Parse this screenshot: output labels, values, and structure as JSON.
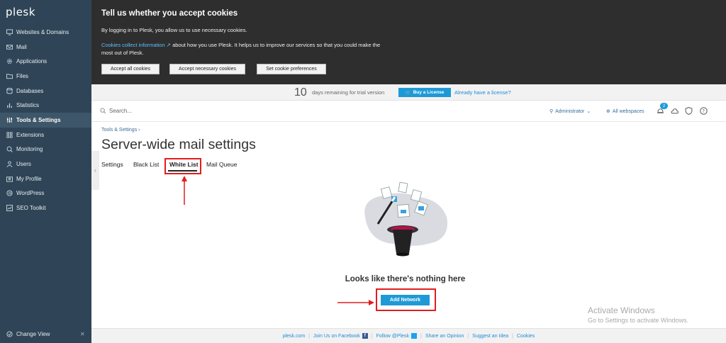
{
  "app": {
    "logo": "plesk"
  },
  "sidebar": {
    "items": [
      {
        "label": "Websites & Domains",
        "icon": "monitor-icon"
      },
      {
        "label": "Mail",
        "icon": "mail-icon"
      },
      {
        "label": "Applications",
        "icon": "gear-icon"
      },
      {
        "label": "Files",
        "icon": "folder-icon"
      },
      {
        "label": "Databases",
        "icon": "database-icon"
      },
      {
        "label": "Statistics",
        "icon": "bar-chart-icon"
      },
      {
        "label": "Tools & Settings",
        "icon": "sliders-icon",
        "active": true
      },
      {
        "label": "Extensions",
        "icon": "grid-icon"
      },
      {
        "label": "Monitoring",
        "icon": "monitoring-icon"
      },
      {
        "label": "Users",
        "icon": "user-icon"
      },
      {
        "label": "My Profile",
        "icon": "profile-icon"
      },
      {
        "label": "WordPress",
        "icon": "wordpress-icon"
      },
      {
        "label": "SEO Toolkit",
        "icon": "seo-icon"
      }
    ],
    "change_view": "Change View"
  },
  "cookie": {
    "title": "Tell us whether you accept cookies",
    "text1": "By logging in to Plesk, you allow us to use necessary cookies.",
    "link": "Cookies collect information",
    "text2": " about how you use Plesk. It helps us to improve our services so that you could make the most out of Plesk.",
    "buttons": [
      "Accept all cookies",
      "Accept necessary cookies",
      "Set cookie preferences"
    ]
  },
  "trial": {
    "days": "10",
    "text": "days remaining for trial version",
    "buy": "Buy a License",
    "have": "Already have a license?"
  },
  "header": {
    "search_placeholder": "Search...",
    "admin": "Administrator",
    "webspaces": "All webspaces",
    "notification_count": "2"
  },
  "main": {
    "breadcrumb": "Tools & Settings",
    "title": "Server-wide mail settings",
    "tabs": [
      {
        "label": "Settings"
      },
      {
        "label": "Black List"
      },
      {
        "label": "White List",
        "active": true
      },
      {
        "label": "Mail Queue"
      }
    ],
    "empty_text": "Looks like there's nothing here",
    "add_button": "Add Network"
  },
  "watermark": {
    "line1": "Activate Windows",
    "line2": "Go to Settings to activate Windows."
  },
  "footer": {
    "links": [
      "plesk.com",
      "Join Us on Facebook",
      "Follow @Plesk",
      "Share an Opinion",
      "Suggest an Idea",
      "Cookies"
    ]
  },
  "colors": {
    "sidebar_bg": "#2f4557",
    "accent": "#1d9ad6",
    "annotation_red": "#e31d1d"
  }
}
